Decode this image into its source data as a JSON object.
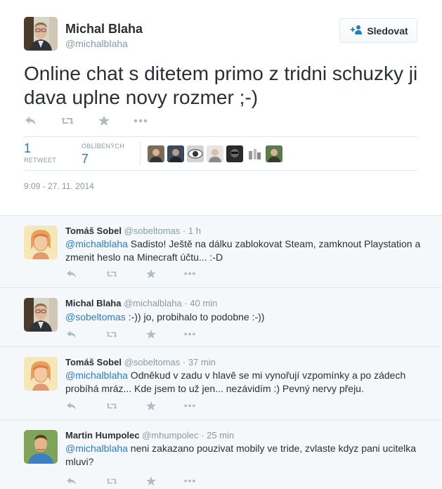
{
  "tweet": {
    "author_name": "Michal Blaha",
    "author_handle": "@michalblaha",
    "follow_label": "Sledovat",
    "text": "Online chat s ditetem primo z tridni schuzky ji dava uplne novy rozmer ;-)",
    "retweets": {
      "count": "1",
      "label": "RETWEET"
    },
    "favorites": {
      "count": "7",
      "label": "OBLÍBENÝCH"
    },
    "timestamp": "9:09 - 27. 11. 2014"
  },
  "replies": [
    {
      "name": "Tomáš Sobel",
      "handle": "@sobeltomas",
      "sep": "·",
      "time": "1 h",
      "mention": "@michalblaha",
      "text": " Sadisto! Ještě na dálku zablokovat Steam, zamknout Playstation a zmenit heslo na Minecraft účtu... :-D"
    },
    {
      "name": "Michal Blaha",
      "handle": "@michalblaha",
      "sep": "·",
      "time": "40 min",
      "mention": "@sobeltomas",
      "text": " :-)) jo, probihalo to podobne :-))"
    },
    {
      "name": "Tomáš Sobel",
      "handle": "@sobeltomas",
      "sep": "·",
      "time": "37 min",
      "mention": "@michalblaha",
      "text": " Odněkud v zadu v hlavě se mi vynořují vzpomínky a po zádech probíhá mráz... Kde jsem to už jen... nezávidím :) Pevný nervy přeju."
    },
    {
      "name": "Martin Humpolec",
      "handle": "@mhumpolec",
      "sep": "·",
      "time": "25 min",
      "mention": "@michalblaha",
      "text": " neni zakazano pouzivat mobily ve tride, zvlaste kdyz pani ucitelka mluvi?"
    }
  ],
  "colors": {
    "link": "#2b7bb9",
    "muted": "#8899a6",
    "text": "#292f33",
    "action_icon": "#b1bbc3",
    "reply_bg": "#f5f8fa"
  },
  "icons": [
    "reply-icon",
    "retweet-icon",
    "favorite-icon",
    "more-icon",
    "follow-person-icon"
  ]
}
